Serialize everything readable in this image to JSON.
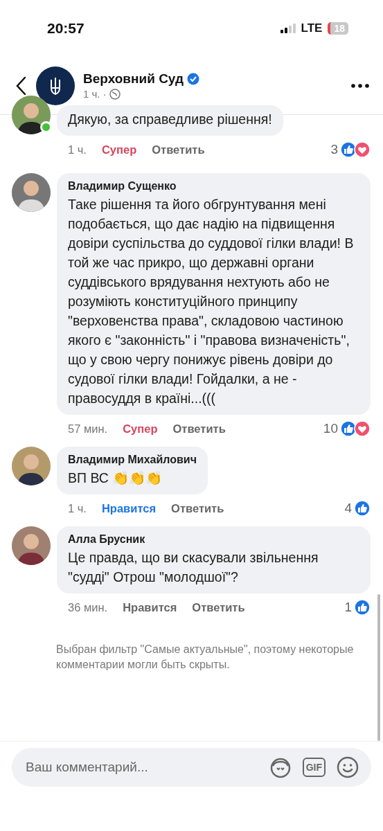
{
  "status_bar": {
    "time": "20:57",
    "network": "LTE",
    "battery": "18"
  },
  "header": {
    "title": "Верховний Суд",
    "verified": true,
    "time": "1 ч.",
    "separator": "·"
  },
  "comments": [
    {
      "online": true,
      "text": "Дякую, за справедливе рішення!",
      "time": "1 ч.",
      "reaction": {
        "label": "Супер",
        "kind": "love"
      },
      "reply": "Ответить",
      "count": "3",
      "reaction_icons": [
        {
          "kind": "like"
        },
        {
          "kind": "love"
        }
      ]
    },
    {
      "author": "Владимир Сущенко",
      "online": false,
      "text": "Таке рішення та його обгрунтування мені подобається, що дає надію на підвищення довіри суспільства до суддової гілки влади! В той же час прикро, що державні органи суддівського врядування нехтують або не розуміють конституційного принципу \"верховенства права\", складовою частиною якого є \"законність\" і \"правова визначеність\", що у свою чергу понижує рівень довіри до судової гілки влади! Гойдалки, а не - правосуддя в країні...(((",
      "time": "57 мин.",
      "reaction": {
        "label": "Супер",
        "kind": "love"
      },
      "reply": "Ответить",
      "count": "10",
      "reaction_icons": [
        {
          "kind": "like"
        },
        {
          "kind": "love"
        }
      ]
    },
    {
      "author": "Владимир Михайлович",
      "online": false,
      "text": "ВП ВС 👏👏👏",
      "time": "1 ч.",
      "reaction": {
        "label": "Нравится",
        "kind": "like"
      },
      "reply": "Ответить",
      "count": "4",
      "reaction_icons": [
        {
          "kind": "like"
        }
      ]
    },
    {
      "author": "Алла Брусник",
      "online": false,
      "text": "Це правда, що ви скасували звільнення \"судді\" Отрош \"молодшої\"?",
      "time": "36 мин.",
      "reaction": {
        "label": "Нравится",
        "kind": "none"
      },
      "reply": "Ответить",
      "count": "1",
      "reaction_icons": [
        {
          "kind": "like"
        }
      ]
    }
  ],
  "filter_note": "Выбран фильтр \"Самые актуальные\", поэтому некоторые комментарии могли быть скрыты.",
  "composer": {
    "placeholder": "Ваш комментарий...",
    "gif_label": "GIF"
  }
}
